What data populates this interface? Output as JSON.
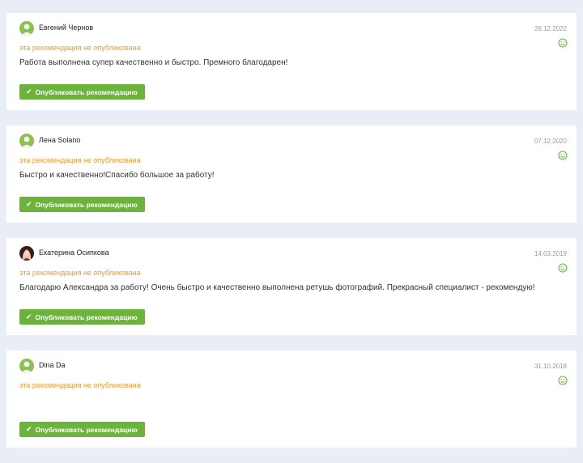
{
  "reviews": [
    {
      "author": "Евгений Чернов",
      "date": "26.12.2022",
      "status": "эта рекомендация не опубликована",
      "text": "Работа выполнена супер качественно и быстро. Премного благодарен!",
      "button": "Опубликовать рекомендацию",
      "avatar": "default-user-avatar",
      "rating_icon": "smile-icon"
    },
    {
      "author": "Лена Solano",
      "date": "07.12.2020",
      "status": "эта рекомендация не опубликована",
      "text": "Быстро и качественно!Спасибо большое за работу!",
      "button": "Опубликовать рекомендацию",
      "avatar": "default-user-avatar",
      "rating_icon": "smile-icon"
    },
    {
      "author": "Екатерина Осипкова",
      "date": "14.03.2019",
      "status": "эта рекомендация не опубликована",
      "text": "Благодарю Александра за работу! Очень быстро и качественно выполнена ретушь фотографий. Прекрасный специалист - рекомендую!",
      "button": "Опубликовать рекомендацию",
      "avatar": "photo-avatar",
      "rating_icon": "smile-icon"
    },
    {
      "author": "Dina Da",
      "date": "31.10.2018",
      "status": "эта рекомендация не опубликована",
      "text": "",
      "button": "Опубликовать рекомендацию",
      "avatar": "default-user-avatar",
      "rating_icon": "smile-icon"
    }
  ],
  "colors": {
    "page_bg": "#e9eef6",
    "status": "#f39a2b",
    "button": "#6bb33b",
    "smile": "#6bb33b",
    "avatar": "#8cc152"
  }
}
